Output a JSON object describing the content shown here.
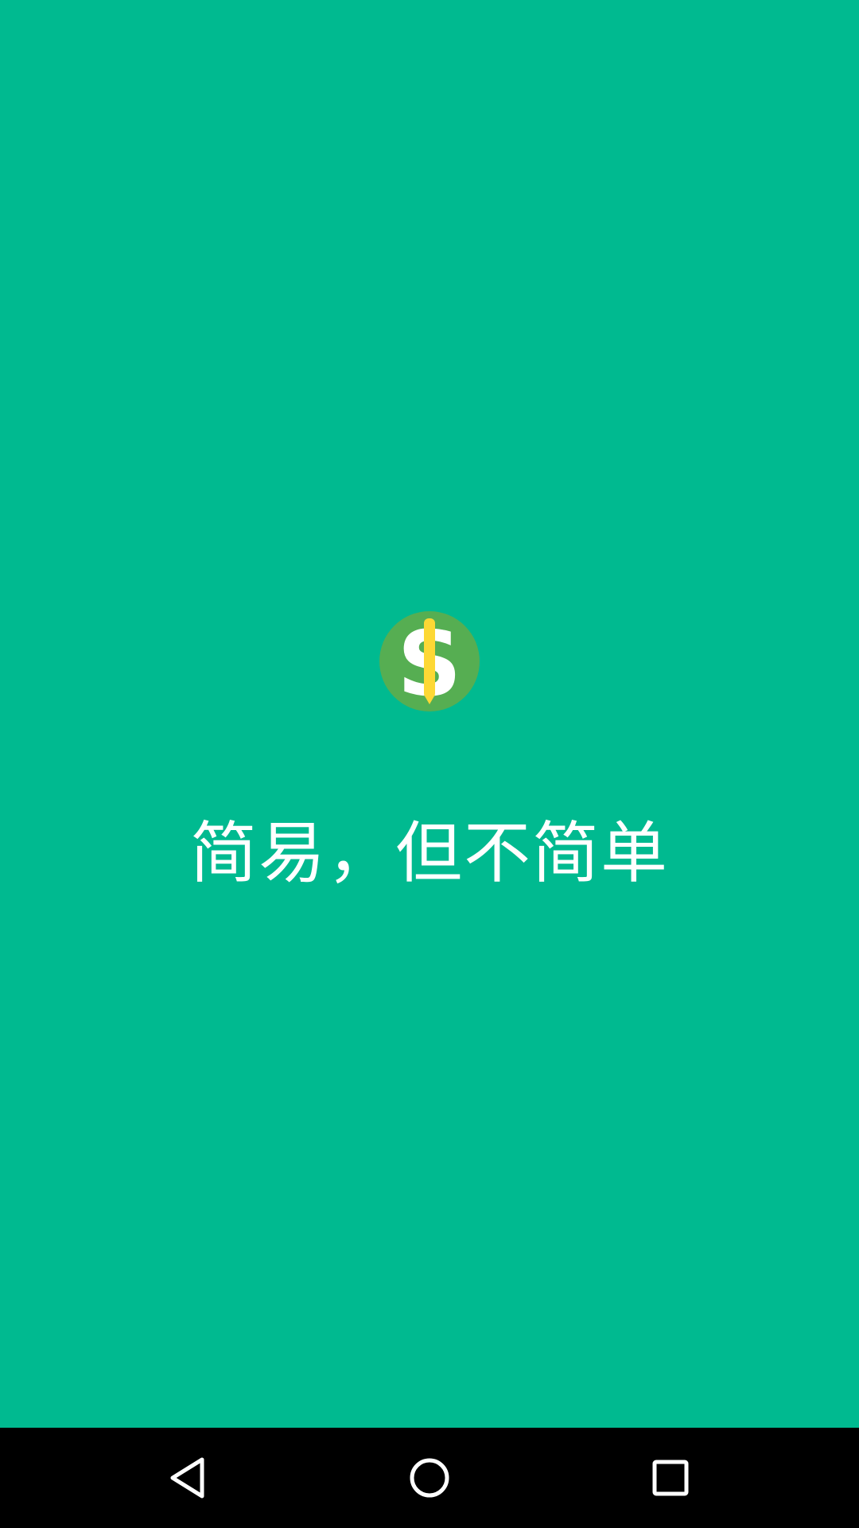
{
  "app": {
    "slogan": "简易，但不简单",
    "logo_icon": "dollar-pencil-icon",
    "background_color": "#00BA90",
    "logo_circle_color": "#56AE52",
    "logo_pencil_color": "#FDD835"
  },
  "navbar": {
    "back_icon": "back-triangle-icon",
    "home_icon": "home-circle-icon",
    "recent_icon": "recent-apps-square-icon"
  }
}
